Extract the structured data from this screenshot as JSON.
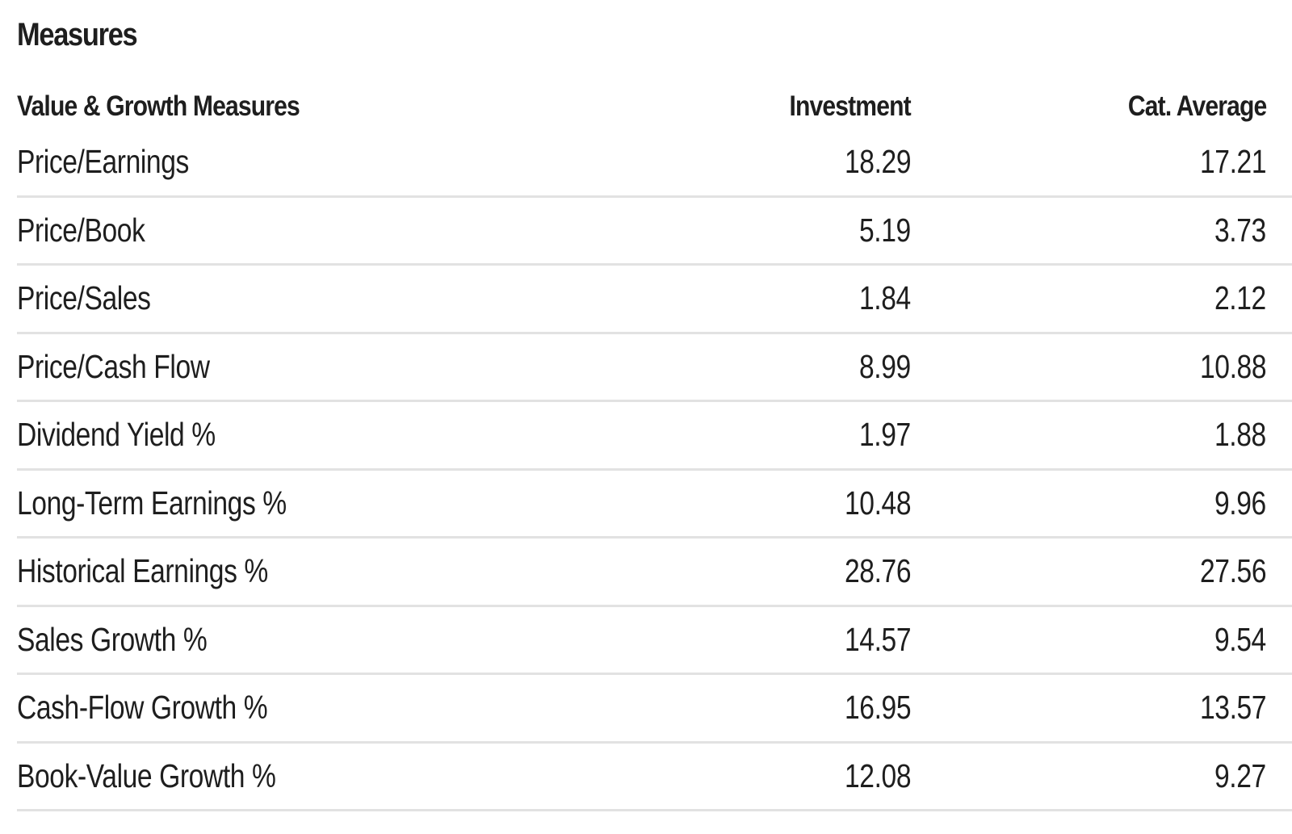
{
  "title": "Measures",
  "table": {
    "headers": {
      "label": "Value & Growth Measures",
      "investment": "Investment",
      "category_average": "Cat. Average"
    },
    "rows": [
      {
        "label": "Price/Earnings",
        "investment": "18.29",
        "category_average": "17.21"
      },
      {
        "label": "Price/Book",
        "investment": "5.19",
        "category_average": "3.73"
      },
      {
        "label": "Price/Sales",
        "investment": "1.84",
        "category_average": "2.12"
      },
      {
        "label": "Price/Cash Flow",
        "investment": "8.99",
        "category_average": "10.88"
      },
      {
        "label": "Dividend Yield %",
        "investment": "1.97",
        "category_average": "1.88"
      },
      {
        "label": "Long-Term Earnings %",
        "investment": "10.48",
        "category_average": "9.96"
      },
      {
        "label": "Historical Earnings %",
        "investment": "28.76",
        "category_average": "27.56"
      },
      {
        "label": "Sales Growth %",
        "investment": "14.57",
        "category_average": "9.54"
      },
      {
        "label": "Cash-Flow Growth %",
        "investment": "16.95",
        "category_average": "13.57"
      },
      {
        "label": "Book-Value Growth %",
        "investment": "12.08",
        "category_average": "9.27"
      }
    ]
  },
  "colors": {
    "text": "#1e1e1e",
    "divider": "#e2e2e2",
    "background": "#ffffff"
  }
}
